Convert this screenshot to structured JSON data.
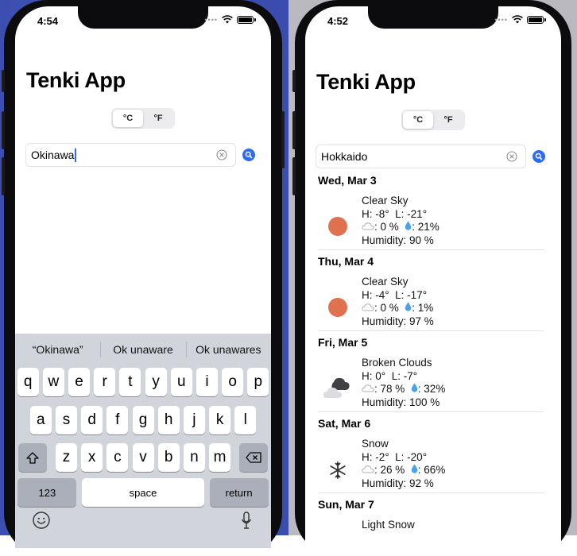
{
  "left_phone": {
    "status_time": "4:54",
    "title": "Tenki App",
    "units": [
      "°C",
      "°F"
    ],
    "selected_unit": "°C",
    "search_value": "Okinawa",
    "suggestions": [
      "“Okinawa”",
      "Ok unaware",
      "Ok unawares"
    ],
    "keys_row1": [
      "q",
      "w",
      "e",
      "r",
      "t",
      "y",
      "u",
      "i",
      "o",
      "p"
    ],
    "keys_row2": [
      "a",
      "s",
      "d",
      "f",
      "g",
      "h",
      "j",
      "k",
      "l"
    ],
    "keys_row3": [
      "z",
      "x",
      "c",
      "v",
      "b",
      "n",
      "m"
    ],
    "key_numbers": "123",
    "key_space": "space",
    "key_return": "return"
  },
  "right_phone": {
    "status_time": "4:52",
    "title": "Tenki App",
    "units": [
      "°C",
      "°F"
    ],
    "selected_unit": "°C",
    "search_value": "Hokkaido",
    "forecast": [
      {
        "date": "Wed, Mar 3",
        "condition": "Clear Sky",
        "high": "H: -8°",
        "low": "L: -21°",
        "cloud": ": 0 %",
        "rain": ": 21%",
        "humidity": "Humidity: 90 %",
        "icon": "sun-icon"
      },
      {
        "date": "Thu, Mar 4",
        "condition": "Clear Sky",
        "high": "H: -4°",
        "low": "L: -17°",
        "cloud": ": 0 %",
        "rain": ": 1%",
        "humidity": "Humidity: 97 %",
        "icon": "sun-icon"
      },
      {
        "date": "Fri, Mar 5",
        "condition": "Broken Clouds",
        "high": "H: 0°",
        "low": "L: -7°",
        "cloud": ": 78 %",
        "rain": ": 32%",
        "humidity": "Humidity: 100 %",
        "icon": "broken-clouds-icon"
      },
      {
        "date": "Sat, Mar 6",
        "condition": "Snow",
        "high": "H: -2°",
        "low": "L: -20°",
        "cloud": ": 26 %",
        "rain": ": 66%",
        "humidity": "Humidity: 92 %",
        "icon": "snowflake-icon"
      },
      {
        "date": "Sun, Mar 7",
        "condition": "Light Snow",
        "icon": "snowflake-icon"
      }
    ]
  },
  "colors": {
    "accent": "#2f6cf6",
    "sun": "#e0714f",
    "background_left": "#3f55b8",
    "background_right": "#b9b9bf"
  }
}
